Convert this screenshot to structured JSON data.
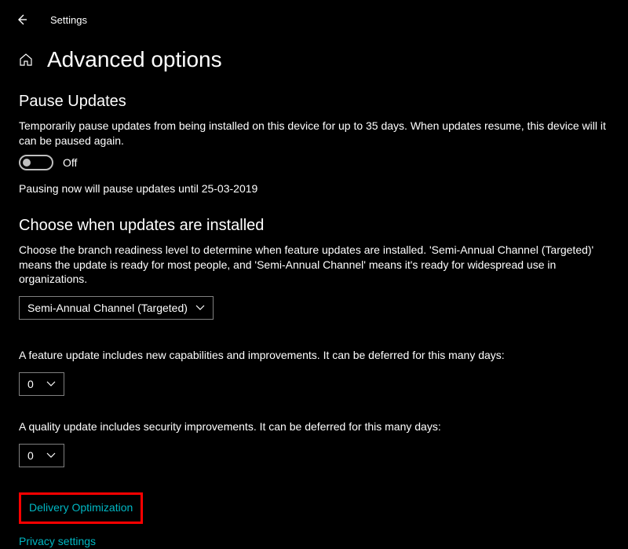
{
  "app": {
    "title": "Settings"
  },
  "page": {
    "title": "Advanced options"
  },
  "pause": {
    "heading": "Pause Updates",
    "description": "Temporarily pause updates from being installed on this device for up to 35 days. When updates resume, this device will it can be paused again.",
    "toggle_state": "Off",
    "note": "Pausing now will pause updates until 25-03-2019"
  },
  "choose": {
    "heading": "Choose when updates are installed",
    "description": "Choose the branch readiness level to determine when feature updates are installed. 'Semi-Annual Channel (Targeted)' means the update is ready for most people, and 'Semi-Annual Channel' means it's ready for widespread use in organizations.",
    "branch_selected": "Semi-Annual Channel (Targeted)",
    "feature_text": "A feature update includes new capabilities and improvements. It can be deferred for this many days:",
    "feature_days": "0",
    "quality_text": "A quality update includes security improvements. It can be deferred for this many days:",
    "quality_days": "0"
  },
  "links": {
    "delivery": "Delivery Optimization",
    "privacy": "Privacy settings"
  }
}
